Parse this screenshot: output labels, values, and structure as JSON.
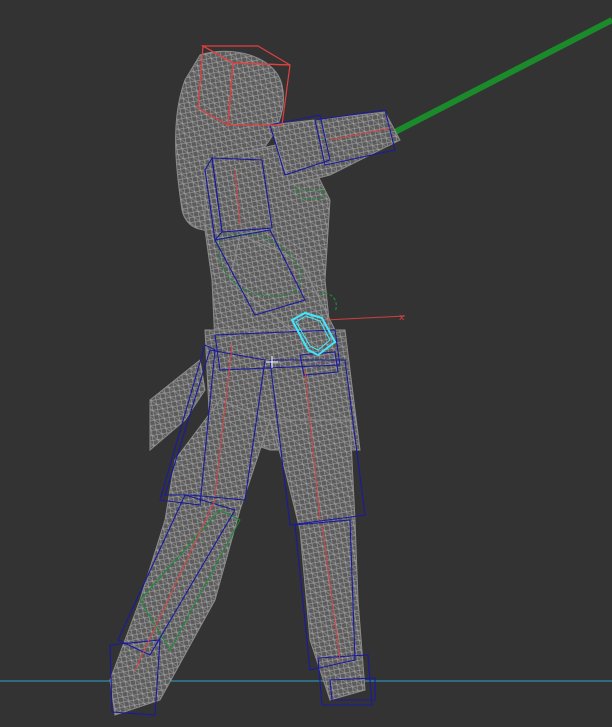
{
  "viewport": {
    "background": "#333333",
    "mesh_color": "#c8c8c8",
    "bone_box_color": "#1a1aa0",
    "bone_line_color": "#e04040",
    "helper_color": "#1e8a3a",
    "selected_color": "#3fe8ff",
    "ground_line_color": "#2aa6c8",
    "weapon_color": "#1a8a2a"
  },
  "icons": {
    "selected_hand_bone": "selection-outline-icon",
    "pivot": "pivot-crosshair-icon"
  }
}
